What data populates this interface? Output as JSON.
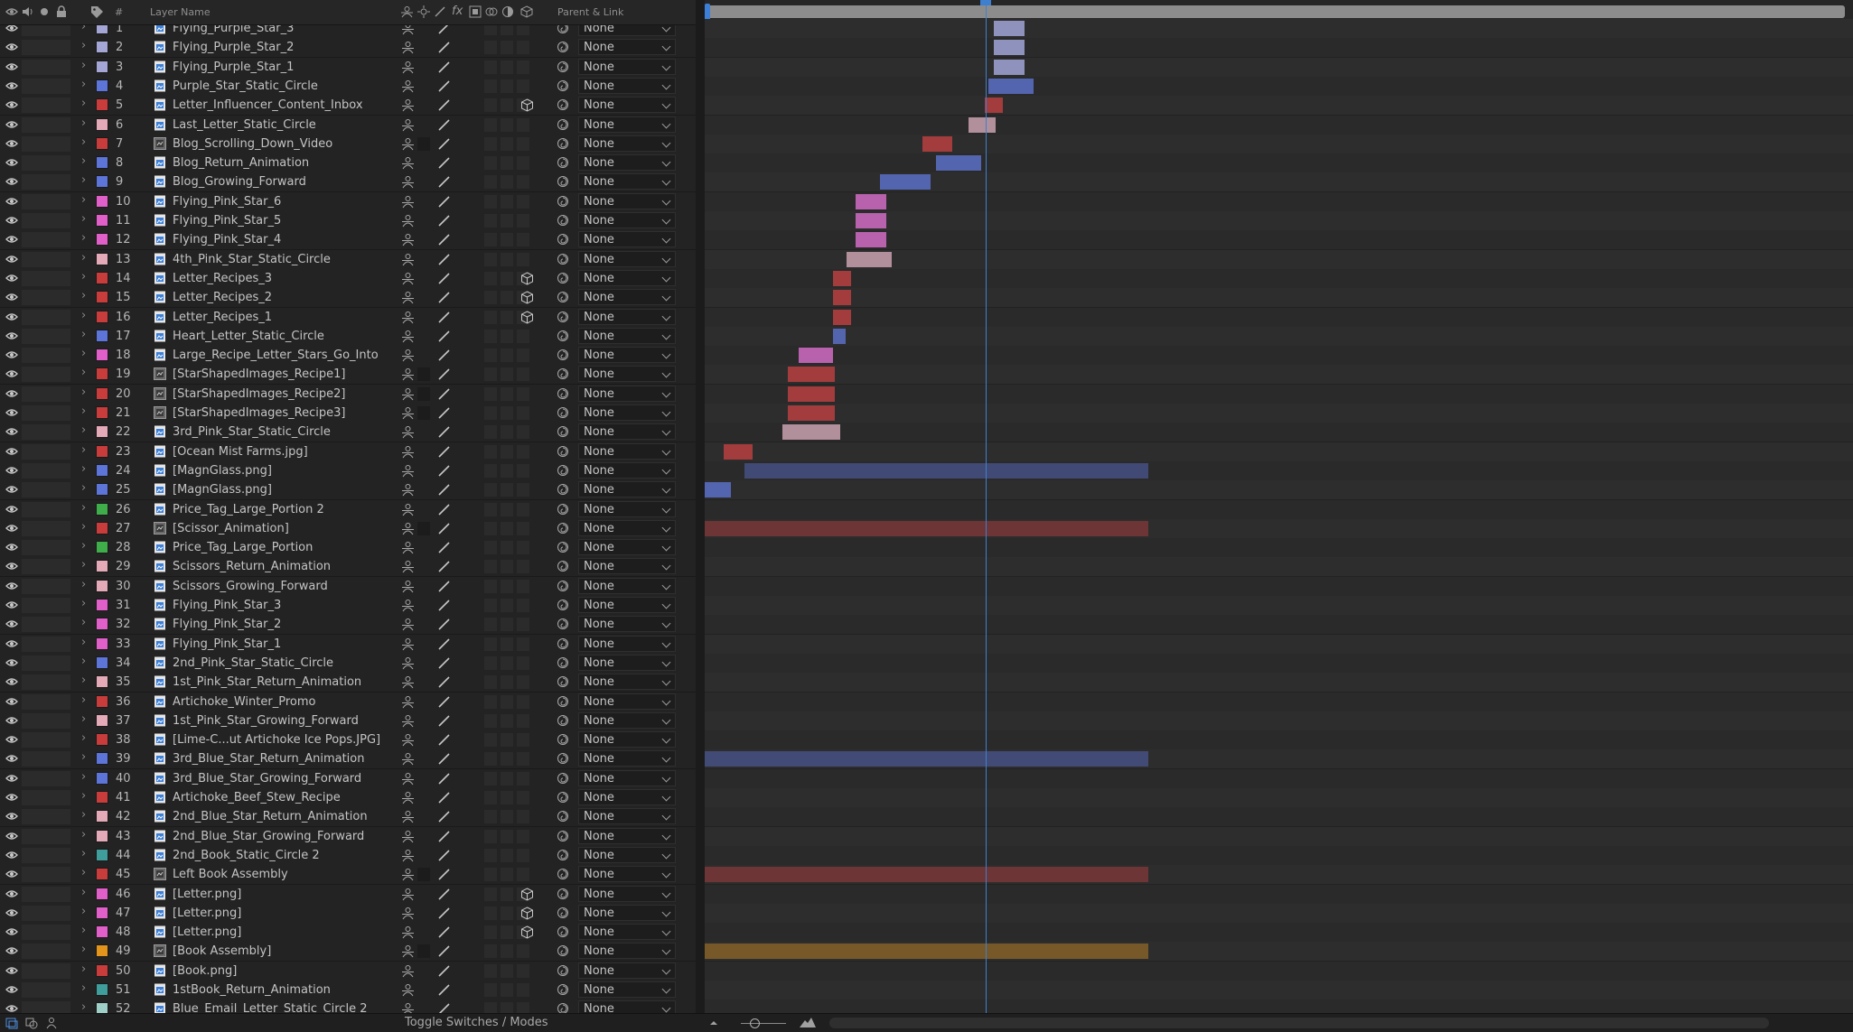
{
  "header": {
    "label_col": "#",
    "layer_name": "Layer Name",
    "parent_link": "Parent & Link"
  },
  "parent_default": "None",
  "bottom": {
    "toggle_label": "Toggle Switches / Modes"
  },
  "label_colors": {
    "lavender": "#a4a6d6",
    "blue": "#5d74d8",
    "red": "#c93c3c",
    "pink": "#e4aab8",
    "magenta": "#e15fc9",
    "green": "#3fae4a",
    "teal": "#3f9d9b",
    "orange": "#e2941b",
    "seafoam": "#9fd0c8"
  },
  "layers": [
    {
      "num": "1",
      "name": "Flying_Purple_Star_3",
      "color": "lavender",
      "type": "comp",
      "cube": false
    },
    {
      "num": "2",
      "name": "Flying_Purple_Star_2",
      "color": "lavender",
      "type": "comp",
      "cube": false
    },
    {
      "num": "3",
      "name": "Flying_Purple_Star_1",
      "color": "lavender",
      "type": "comp",
      "cube": false
    },
    {
      "num": "4",
      "name": "Purple_Star_Static_Circle",
      "color": "blue",
      "type": "comp",
      "cube": false
    },
    {
      "num": "5",
      "name": "Letter_Influencer_Content_Inbox",
      "color": "red",
      "type": "comp",
      "cube": true
    },
    {
      "num": "6",
      "name": "Last_Letter_Static_Circle",
      "color": "pink",
      "type": "comp",
      "cube": false
    },
    {
      "num": "7",
      "name": "Blog_Scrolling_Down_Video",
      "color": "red",
      "type": "footage",
      "cube": false
    },
    {
      "num": "8",
      "name": "Blog_Return_Animation",
      "color": "blue",
      "type": "comp",
      "cube": false
    },
    {
      "num": "9",
      "name": "Blog_Growing_Forward",
      "color": "blue",
      "type": "comp",
      "cube": false
    },
    {
      "num": "10",
      "name": "Flying_Pink_Star_6",
      "color": "magenta",
      "type": "comp",
      "cube": false
    },
    {
      "num": "11",
      "name": "Flying_Pink_Star_5",
      "color": "magenta",
      "type": "comp",
      "cube": false
    },
    {
      "num": "12",
      "name": "Flying_Pink_Star_4",
      "color": "magenta",
      "type": "comp",
      "cube": false
    },
    {
      "num": "13",
      "name": "4th_Pink_Star_Static_Circle",
      "color": "pink",
      "type": "comp",
      "cube": false
    },
    {
      "num": "14",
      "name": "Letter_Recipes_3",
      "color": "red",
      "type": "comp",
      "cube": true
    },
    {
      "num": "15",
      "name": "Letter_Recipes_2",
      "color": "red",
      "type": "comp",
      "cube": true
    },
    {
      "num": "16",
      "name": "Letter_Recipes_1",
      "color": "red",
      "type": "comp",
      "cube": true
    },
    {
      "num": "17",
      "name": "Heart_Letter_Static_Circle",
      "color": "blue",
      "type": "comp",
      "cube": false
    },
    {
      "num": "18",
      "name": "Large_Recipe_Letter_Stars_Go_Into",
      "color": "magenta",
      "type": "comp",
      "cube": false
    },
    {
      "num": "19",
      "name": "[StarShapedImages_Recipe1]",
      "color": "red",
      "type": "footage",
      "cube": false
    },
    {
      "num": "20",
      "name": "[StarShapedImages_Recipe2]",
      "color": "red",
      "type": "footage",
      "cube": false
    },
    {
      "num": "21",
      "name": "[StarShapedImages_Recipe3]",
      "color": "red",
      "type": "footage",
      "cube": false
    },
    {
      "num": "22",
      "name": "3rd_Pink_Star_Static_Circle",
      "color": "pink",
      "type": "comp",
      "cube": false
    },
    {
      "num": "23",
      "name": "[Ocean Mist Farms.jpg]",
      "color": "red",
      "type": "comp",
      "cube": false
    },
    {
      "num": "24",
      "name": "[MagnGlass.png]",
      "color": "blue",
      "type": "comp",
      "cube": false
    },
    {
      "num": "25",
      "name": "[MagnGlass.png]",
      "color": "blue",
      "type": "comp",
      "cube": false
    },
    {
      "num": "26",
      "name": "Price_Tag_Large_Portion 2",
      "color": "green",
      "type": "comp",
      "cube": false
    },
    {
      "num": "27",
      "name": "[Scissor_Animation]",
      "color": "red",
      "type": "footage",
      "cube": false
    },
    {
      "num": "28",
      "name": "Price_Tag_Large_Portion",
      "color": "green",
      "type": "comp",
      "cube": false
    },
    {
      "num": "29",
      "name": "Scissors_Return_Animation",
      "color": "pink",
      "type": "comp",
      "cube": false
    },
    {
      "num": "30",
      "name": "Scissors_Growing_Forward",
      "color": "pink",
      "type": "comp",
      "cube": false
    },
    {
      "num": "31",
      "name": "Flying_Pink_Star_3",
      "color": "magenta",
      "type": "comp",
      "cube": false
    },
    {
      "num": "32",
      "name": "Flying_Pink_Star_2",
      "color": "magenta",
      "type": "comp",
      "cube": false
    },
    {
      "num": "33",
      "name": "Flying_Pink_Star_1",
      "color": "magenta",
      "type": "comp",
      "cube": false
    },
    {
      "num": "34",
      "name": "2nd_Pink_Star_Static_Circle",
      "color": "blue",
      "type": "comp",
      "cube": false
    },
    {
      "num": "35",
      "name": "1st_Pink_Star_Return_Animation",
      "color": "pink",
      "type": "comp",
      "cube": false
    },
    {
      "num": "36",
      "name": "Artichoke_Winter_Promo",
      "color": "red",
      "type": "comp",
      "cube": false
    },
    {
      "num": "37",
      "name": "1st_Pink_Star_Growing_Forward",
      "color": "pink",
      "type": "comp",
      "cube": false
    },
    {
      "num": "38",
      "name": "[Lime-C...ut Artichoke Ice Pops.JPG]",
      "color": "red",
      "type": "comp",
      "cube": false
    },
    {
      "num": "39",
      "name": "3rd_Blue_Star_Return_Animation",
      "color": "blue",
      "type": "comp",
      "cube": false
    },
    {
      "num": "40",
      "name": "3rd_Blue_Star_Growing_Forward",
      "color": "blue",
      "type": "comp",
      "cube": false
    },
    {
      "num": "41",
      "name": "Artichoke_Beef_Stew_Recipe",
      "color": "red",
      "type": "comp",
      "cube": false
    },
    {
      "num": "42",
      "name": "2nd_Blue_Star_Return_Animation",
      "color": "pink",
      "type": "comp",
      "cube": false
    },
    {
      "num": "43",
      "name": "2nd_Blue_Star_Growing_Forward",
      "color": "pink",
      "type": "comp",
      "cube": false
    },
    {
      "num": "44",
      "name": "2nd_Book_Static_Circle 2",
      "color": "teal",
      "type": "comp",
      "cube": false
    },
    {
      "num": "45",
      "name": "Left Book Assembly",
      "color": "red",
      "type": "footage",
      "cube": false
    },
    {
      "num": "46",
      "name": "[Letter.png]",
      "color": "magenta",
      "type": "comp",
      "cube": true
    },
    {
      "num": "47",
      "name": "[Letter.png]",
      "color": "magenta",
      "type": "comp",
      "cube": true
    },
    {
      "num": "48",
      "name": "[Letter.png]",
      "color": "magenta",
      "type": "comp",
      "cube": true
    },
    {
      "num": "49",
      "name": "[Book Assembly]",
      "color": "orange",
      "type": "footage",
      "cube": false
    },
    {
      "num": "50",
      "name": "[Book.png]",
      "color": "red",
      "type": "comp",
      "cube": false
    },
    {
      "num": "51",
      "name": "1stBook_Return_Animation",
      "color": "teal",
      "type": "comp",
      "cube": false
    },
    {
      "num": "52",
      "name": "Blue_Email_Letter_Static_Circle 2",
      "color": "seafoam",
      "type": "comp",
      "cube": false
    }
  ]
}
